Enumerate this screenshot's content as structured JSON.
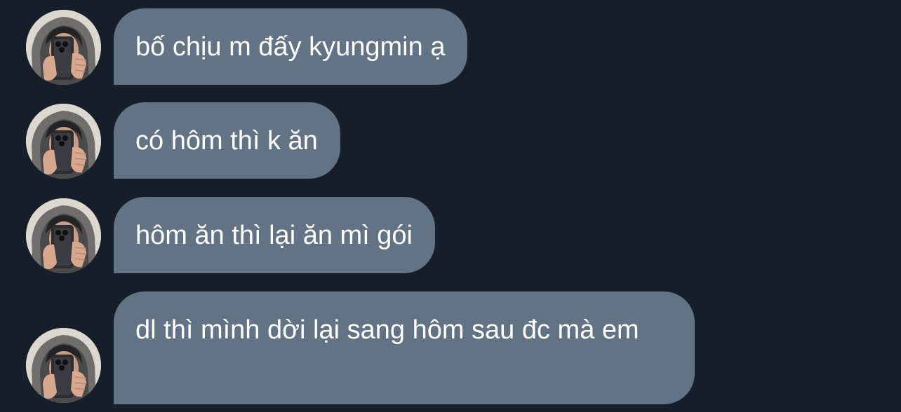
{
  "conversation": {
    "sender_avatar_icon": "user-avatar-photo",
    "bubble_color": "#627385",
    "background_color": "#161f29",
    "messages": [
      {
        "text": "bố chịu m đấy kyungmin ạ"
      },
      {
        "text": "có hôm thì k ăn"
      },
      {
        "text": "hôm ăn thì lại ăn mì gói"
      },
      {
        "text": "dl thì mình dời lại sang hôm sau đc mà em"
      }
    ]
  }
}
